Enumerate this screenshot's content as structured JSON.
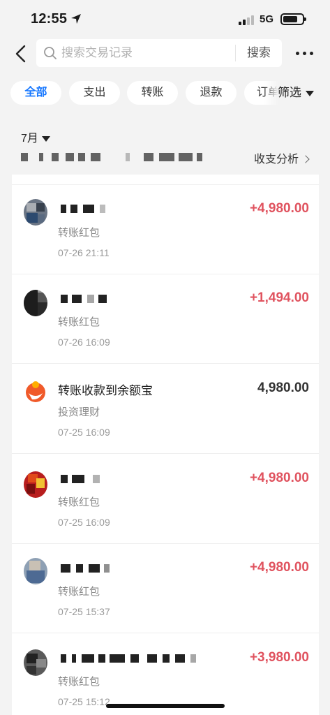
{
  "status_bar": {
    "time": "12:55",
    "network": "5G"
  },
  "search": {
    "placeholder": "搜索交易记录",
    "button": "搜索"
  },
  "filters": {
    "chips": [
      "全部",
      "支出",
      "转账",
      "退款",
      "订单"
    ],
    "active": "全部",
    "filter_label": "筛选"
  },
  "summary": {
    "month": "7月",
    "analysis_label": "收支分析"
  },
  "transactions": [
    {
      "category": "转账红包",
      "time": "07-26 21:11",
      "amount": "+4,980.00",
      "color": "#e0535f"
    },
    {
      "category": "转账红包",
      "time": "07-26 16:09",
      "amount": "+1,494.00",
      "color": "#e0535f"
    },
    {
      "title": "转账收款到余额宝",
      "category": "投资理财",
      "time": "07-25 16:09",
      "amount": "4,980.00",
      "color": "#333333"
    },
    {
      "category": "转账红包",
      "time": "07-25 16:09",
      "amount": "+4,980.00",
      "color": "#e0535f"
    },
    {
      "category": "转账红包",
      "time": "07-25 15:37",
      "amount": "+4,980.00",
      "color": "#e0535f"
    },
    {
      "category": "转账红包",
      "time": "07-25 15:12",
      "amount": "+3,980.00",
      "color": "#e0535f"
    }
  ]
}
